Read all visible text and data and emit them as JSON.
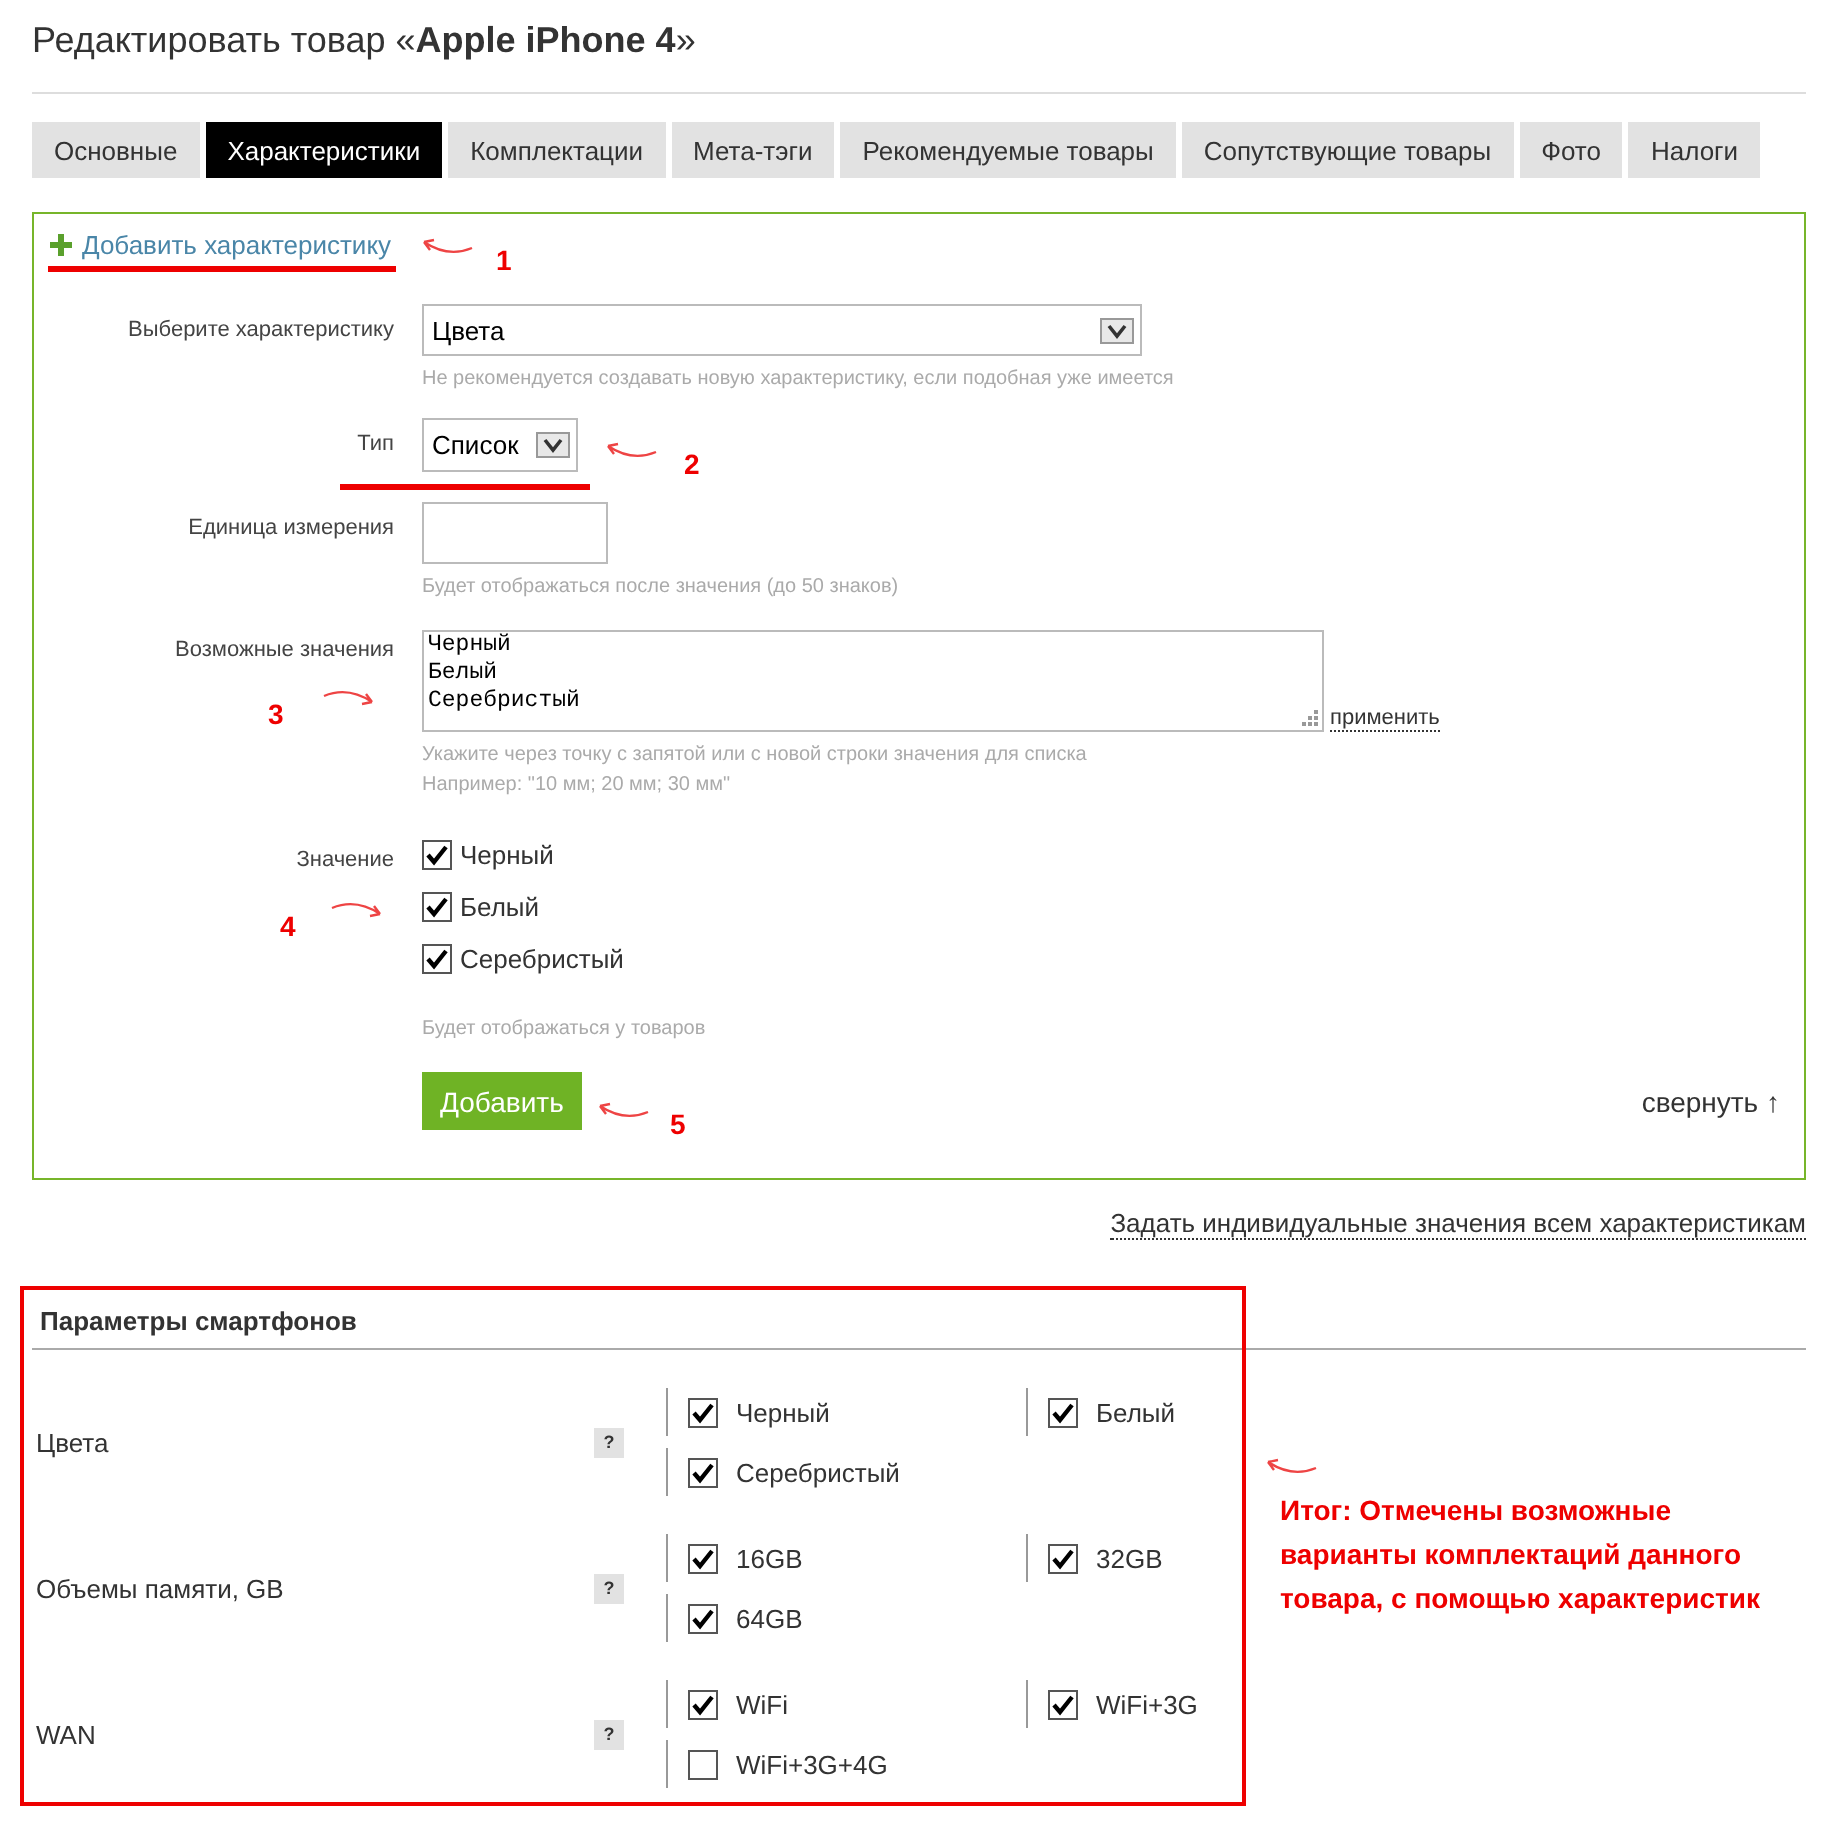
{
  "page_title": "Редактировать товар «**Apple iPhone 4**»",
  "tabs": [
    {
      "label": "Основные",
      "selected": false
    },
    {
      "label": "Характеристики",
      "selected": true
    },
    {
      "label": "Комплектации",
      "selected": false
    },
    {
      "label": "Мета-тэги",
      "selected": false
    },
    {
      "label": "Рекомендуемые товары",
      "selected": false
    },
    {
      "label": "Сопутствующие товары",
      "selected": false
    },
    {
      "label": "Фото",
      "selected": false
    },
    {
      "label": "Налоги",
      "selected": false
    }
  ],
  "form": {
    "add_link": "Добавить характеристику",
    "feature": {
      "label": "Выберите характеристику",
      "value": "Цвета",
      "hint": "Не рекомендуется создавать новую характеристику, если подобная уже имеется"
    },
    "type": {
      "label": "Тип",
      "value": "Список"
    },
    "unit": {
      "label": "Единица измерения",
      "hint": "Будет отображаться после значения (до 50 знаков)"
    },
    "values": {
      "label": "Возможные значения",
      "value": "Черный\nБелый\nСеребристый",
      "apply": "применить",
      "hints": [
        "Укажите через точку с запятой или с новой строки значения для списка",
        "Например: \"10 мм; 20 мм; 30 мм\""
      ]
    },
    "value": {
      "label": "Значение",
      "options": [
        {
          "label": "Черный",
          "checked": true
        },
        {
          "label": "Белый",
          "checked": true
        },
        {
          "label": "Серебристый",
          "checked": true
        }
      ],
      "hint": "Будет отображаться у товаров"
    },
    "submit": "Добавить",
    "collapse": "свернуть ↑"
  },
  "individual_link": "Задать индивидуальные значения всем характеристикам",
  "params": {
    "title": "Параметры смартфонов",
    "rows": [
      {
        "label": "Цвета",
        "help": "?",
        "options": [
          {
            "label": "Черный",
            "checked": true
          },
          {
            "label": "Белый",
            "checked": true
          },
          {
            "label": "Серебристый",
            "checked": true
          }
        ]
      },
      {
        "label": "Объемы памяти, GB",
        "help": "?",
        "options": [
          {
            "label": "16GB",
            "checked": true
          },
          {
            "label": "32GB",
            "checked": true
          },
          {
            "label": "64GB",
            "checked": true
          }
        ]
      },
      {
        "label": "WAN",
        "help": "?",
        "options": [
          {
            "label": "WiFi",
            "checked": true
          },
          {
            "label": "WiFi+3G",
            "checked": true
          },
          {
            "label": "WiFi+3G+4G",
            "checked": false
          }
        ]
      }
    ]
  },
  "annotations": {
    "numbers": [
      "1",
      "2",
      "3",
      "4",
      "5"
    ],
    "summary": "Итог: Отмечены возможные варианты комплектаций данного товара, с помощью характеристик"
  }
}
